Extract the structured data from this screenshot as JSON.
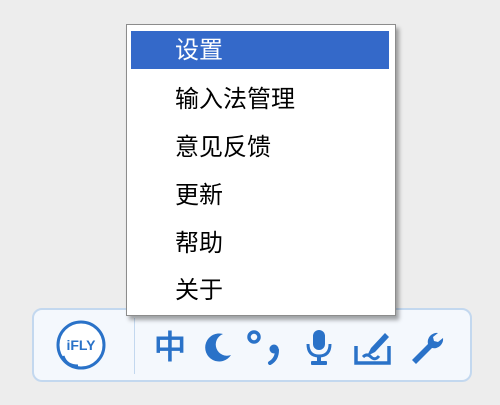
{
  "menu": {
    "items": [
      {
        "label": "设置",
        "active": true
      },
      {
        "label": "输入法管理"
      },
      {
        "label": "意见反馈"
      },
      {
        "label": "更新"
      },
      {
        "label": "帮助"
      },
      {
        "label": "关于"
      }
    ]
  },
  "toolbar": {
    "logo_text": "iFLY",
    "lang_mode": "中",
    "icons": [
      "moon-icon",
      "punctuation-icon",
      "microphone-icon",
      "handwriting-icon",
      "wrench-icon"
    ]
  },
  "colors": {
    "accent": "#2a72c8",
    "menu_highlight": "#3469c9",
    "toolbar_border": "#c3d8ef"
  }
}
